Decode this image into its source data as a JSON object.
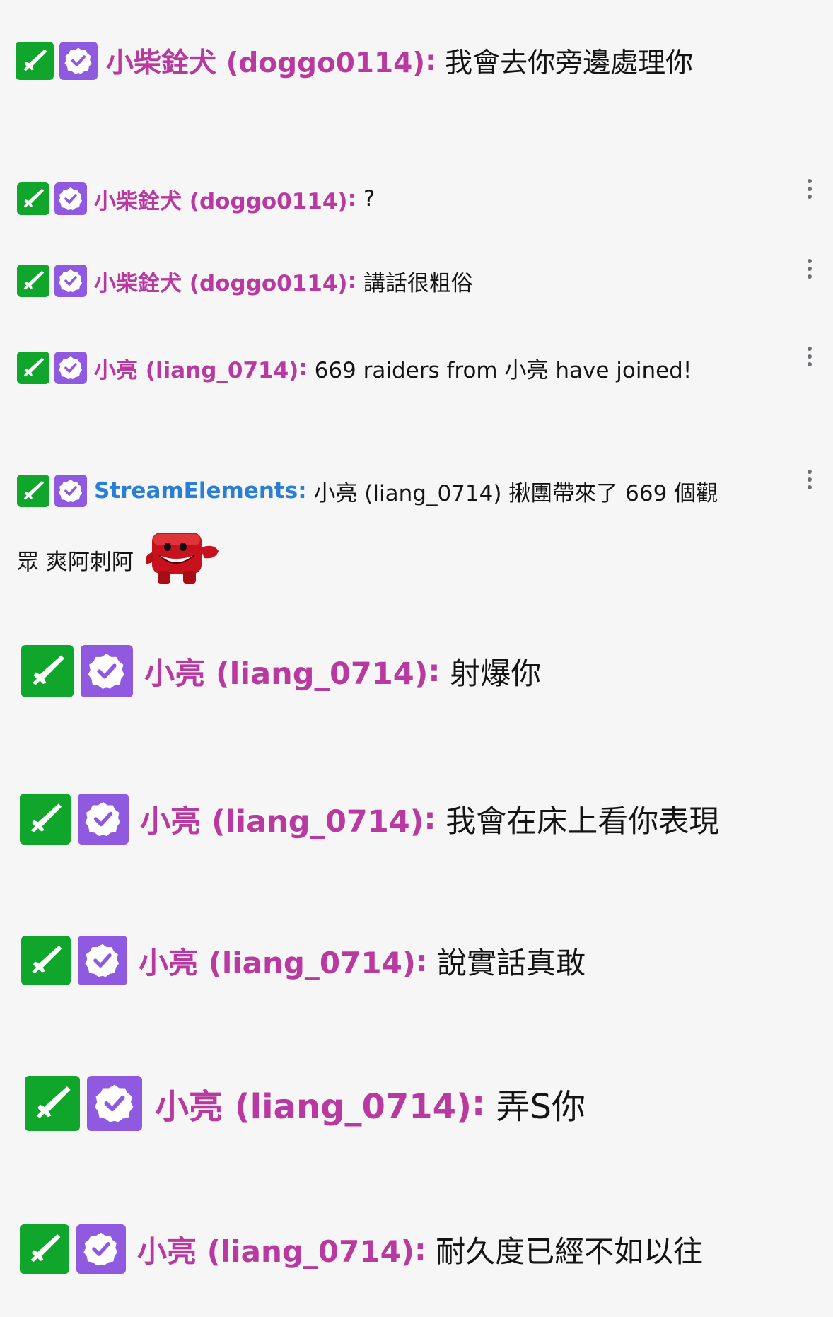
{
  "messages": [
    {
      "user": "小柴銓犬 (doggo0114)",
      "sep": ":",
      "text": "我會去你旁邊處理你"
    },
    {
      "user": "小柴銓犬 (doggo0114)",
      "sep": ":",
      "text": "?"
    },
    {
      "user": "小柴銓犬 (doggo0114)",
      "sep": ":",
      "text": "講話很粗俗"
    },
    {
      "user": "小亮 (liang_0714)",
      "sep": ":",
      "text": "669 raiders from 小亮 have joined!"
    },
    {
      "user": "StreamElements",
      "sep": ":",
      "text": "小亮 (liang_0714) 揪團帶來了 669 個觀",
      "text2": "眾 爽阿刺阿"
    },
    {
      "user": "小亮 (liang_0714)",
      "sep": ":",
      "text": "射爆你"
    },
    {
      "user": "小亮 (liang_0714)",
      "sep": ":",
      "text": "我會在床上看你表現"
    },
    {
      "user": "小亮 (liang_0714)",
      "sep": ":",
      "text": "說實話真敢"
    },
    {
      "user": "小亮 (liang_0714)",
      "sep": ":",
      "text": "弄S你"
    },
    {
      "user": "小亮 (liang_0714)",
      "sep": ":",
      "text": "耐久度已經不如以往"
    }
  ],
  "badges": {
    "moderator_icon": "sword-icon",
    "vip_icon": "verified-check-icon"
  },
  "colors": {
    "username": "#b83aa0",
    "bot_username": "#2a7ed3",
    "moderator_badge": "#10a52b",
    "vip_badge": "#8f59e0",
    "background": "#f6f6f7"
  },
  "emote": {
    "icon": "meat-boy-emote"
  },
  "menu_icon": "more-vertical-icon"
}
